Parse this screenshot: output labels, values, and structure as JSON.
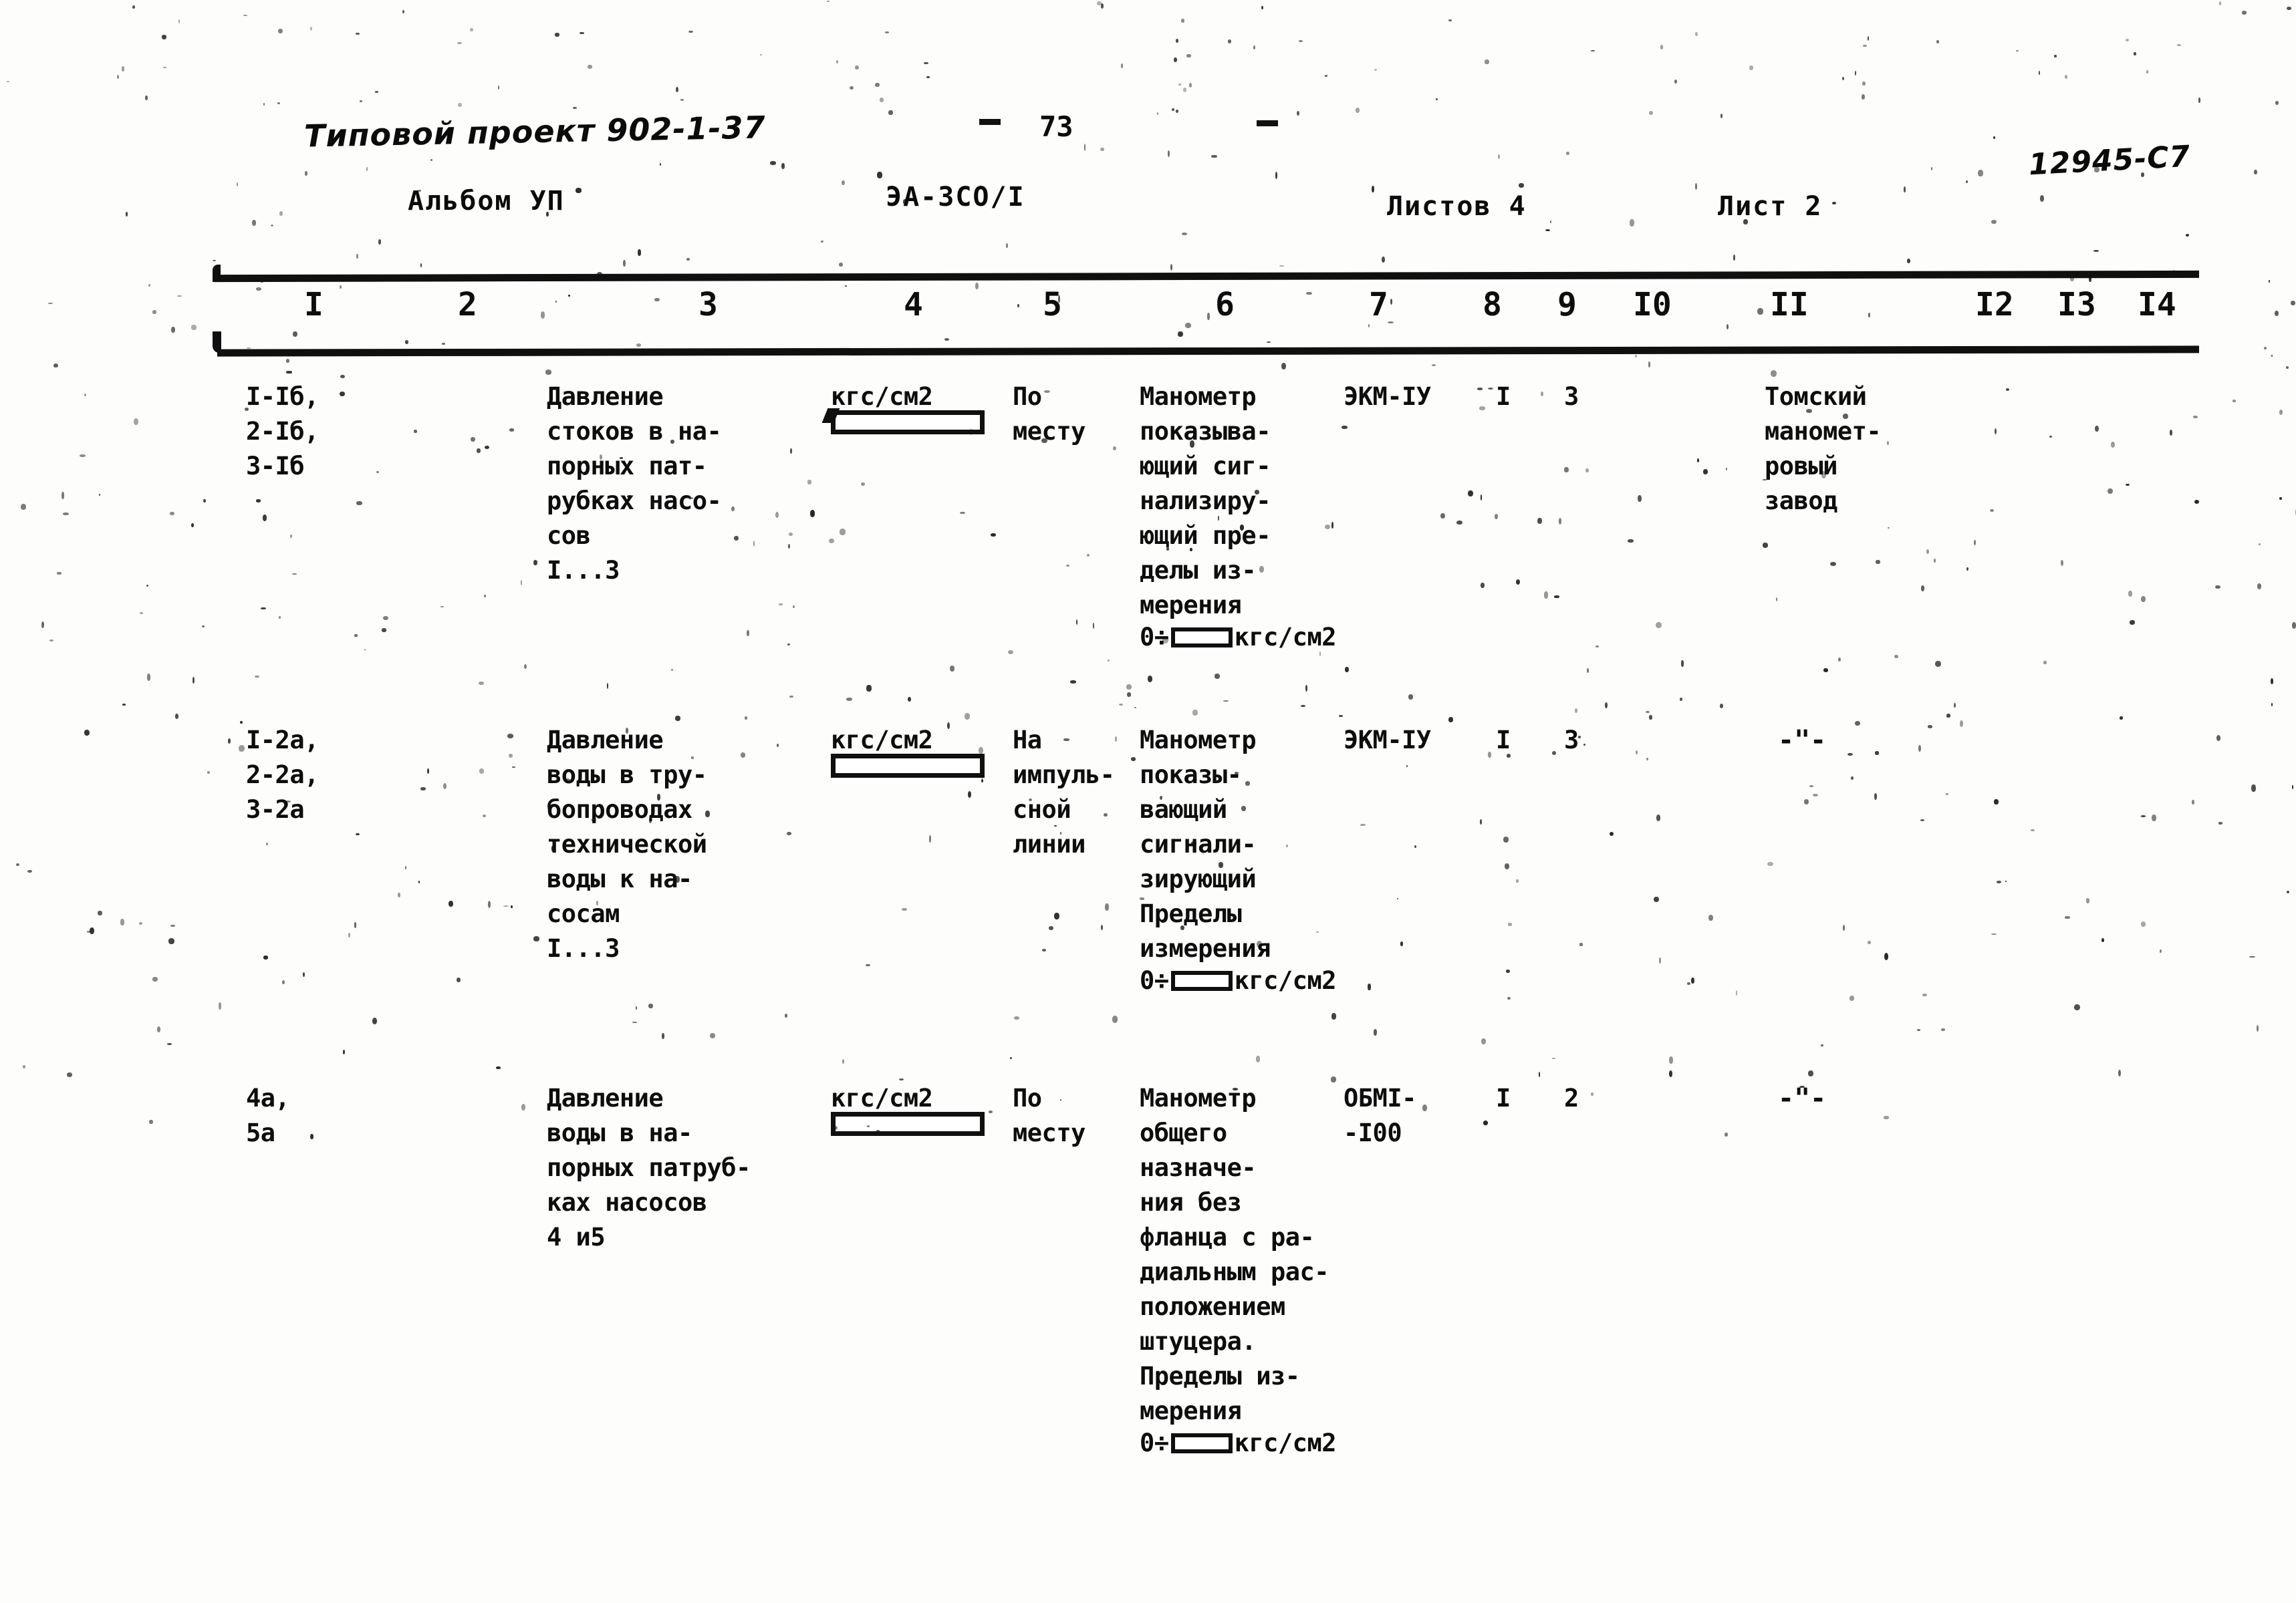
{
  "header": {
    "project_title": "Типовой проект 902-1-37",
    "page_number": "73",
    "doc_code": "12945-С7",
    "album": "Альбом УП",
    "sheet_code": "ЭА-3СО/I",
    "sheets_total": "Листов 4",
    "sheet_number": "Лист 2"
  },
  "table": {
    "column_numbers": [
      "I",
      "2",
      "3",
      "4",
      "5",
      "6",
      "7",
      "8",
      "9",
      "I0",
      "II",
      "I2",
      "I3",
      "I4"
    ],
    "rows": [
      {
        "c1": "I-Iб,\n2-Iб,\n3-Iб",
        "c3": "Давление\nстоков в на-\nпорных пат-\nрубках насо-\nсов\nI...3",
        "c4_unit": "кгс/см2",
        "c5": "По\nместу",
        "c6": "Манометр\nпоказыва-\nющий сиг-\nнализиру-\nющий пре-\nделы из-\nмерения",
        "c6_range_prefix": "0÷",
        "c6_range_suffix": "кгс/см2",
        "c7": "ЭКМ-IУ",
        "c8": "I",
        "c9": "3",
        "c11": "Томский\nманомет-\nровый\nзавод"
      },
      {
        "c1": "I-2а,\n2-2а,\n3-2а",
        "c3": "Давление\nводы в тру-\nбопроводах\nтехнической\nводы к на-\nсосам\nI...3",
        "c4_unit": "кгс/см2",
        "c5": "На\nимпуль-\nсной\nлинии",
        "c6": "Манометр\nпоказы-\nвающий\nсигнали-\nзирующий\nПределы\nизмерения",
        "c6_range_prefix": "0÷",
        "c6_range_suffix": "кгс/см2",
        "c7": "ЭКМ-IУ",
        "c8": "I",
        "c9": "3",
        "c11": "-\"-"
      },
      {
        "c1": "4а,\n5а",
        "c3": "Давление\nводы в на-\nпорных патруб-\nках насосов\n4 и5",
        "c4_unit": "кгс/см2",
        "c5": "По\nместу",
        "c6": "Манометр\nобщего\nназначе-\nния без\nфланца с ра-\nдиальным рас-\nположением\nштуцера.\nПределы из-\nмерения",
        "c6_range_prefix": "0÷",
        "c6_range_suffix": "кгс/см2",
        "c7": "ОБМI-\n-I00",
        "c8": "I",
        "c9": "2",
        "c11": "-\"-"
      }
    ]
  }
}
